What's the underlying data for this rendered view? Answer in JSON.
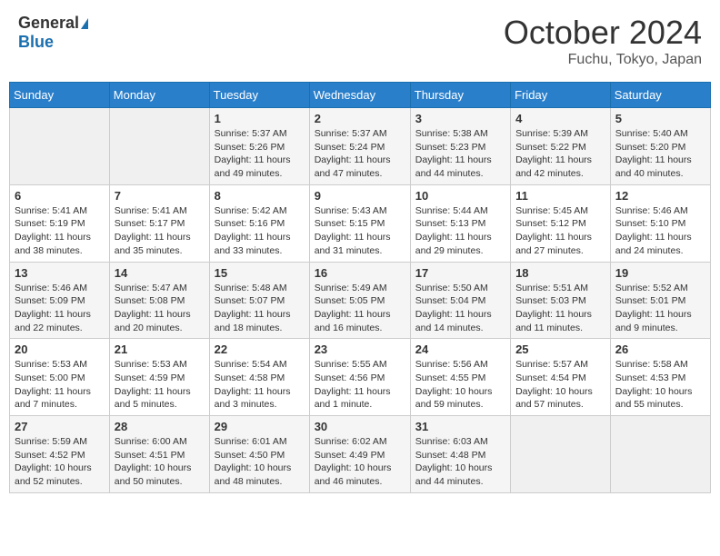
{
  "header": {
    "logo_general": "General",
    "logo_blue": "Blue",
    "month": "October 2024",
    "location": "Fuchu, Tokyo, Japan"
  },
  "days_of_week": [
    "Sunday",
    "Monday",
    "Tuesday",
    "Wednesday",
    "Thursday",
    "Friday",
    "Saturday"
  ],
  "weeks": [
    [
      {
        "day": "",
        "info": ""
      },
      {
        "day": "",
        "info": ""
      },
      {
        "day": "1",
        "sunrise": "5:37 AM",
        "sunset": "5:26 PM",
        "daylight": "11 hours and 49 minutes."
      },
      {
        "day": "2",
        "sunrise": "5:37 AM",
        "sunset": "5:24 PM",
        "daylight": "11 hours and 47 minutes."
      },
      {
        "day": "3",
        "sunrise": "5:38 AM",
        "sunset": "5:23 PM",
        "daylight": "11 hours and 44 minutes."
      },
      {
        "day": "4",
        "sunrise": "5:39 AM",
        "sunset": "5:22 PM",
        "daylight": "11 hours and 42 minutes."
      },
      {
        "day": "5",
        "sunrise": "5:40 AM",
        "sunset": "5:20 PM",
        "daylight": "11 hours and 40 minutes."
      }
    ],
    [
      {
        "day": "6",
        "sunrise": "5:41 AM",
        "sunset": "5:19 PM",
        "daylight": "11 hours and 38 minutes."
      },
      {
        "day": "7",
        "sunrise": "5:41 AM",
        "sunset": "5:17 PM",
        "daylight": "11 hours and 35 minutes."
      },
      {
        "day": "8",
        "sunrise": "5:42 AM",
        "sunset": "5:16 PM",
        "daylight": "11 hours and 33 minutes."
      },
      {
        "day": "9",
        "sunrise": "5:43 AM",
        "sunset": "5:15 PM",
        "daylight": "11 hours and 31 minutes."
      },
      {
        "day": "10",
        "sunrise": "5:44 AM",
        "sunset": "5:13 PM",
        "daylight": "11 hours and 29 minutes."
      },
      {
        "day": "11",
        "sunrise": "5:45 AM",
        "sunset": "5:12 PM",
        "daylight": "11 hours and 27 minutes."
      },
      {
        "day": "12",
        "sunrise": "5:46 AM",
        "sunset": "5:10 PM",
        "daylight": "11 hours and 24 minutes."
      }
    ],
    [
      {
        "day": "13",
        "sunrise": "5:46 AM",
        "sunset": "5:09 PM",
        "daylight": "11 hours and 22 minutes."
      },
      {
        "day": "14",
        "sunrise": "5:47 AM",
        "sunset": "5:08 PM",
        "daylight": "11 hours and 20 minutes."
      },
      {
        "day": "15",
        "sunrise": "5:48 AM",
        "sunset": "5:07 PM",
        "daylight": "11 hours and 18 minutes."
      },
      {
        "day": "16",
        "sunrise": "5:49 AM",
        "sunset": "5:05 PM",
        "daylight": "11 hours and 16 minutes."
      },
      {
        "day": "17",
        "sunrise": "5:50 AM",
        "sunset": "5:04 PM",
        "daylight": "11 hours and 14 minutes."
      },
      {
        "day": "18",
        "sunrise": "5:51 AM",
        "sunset": "5:03 PM",
        "daylight": "11 hours and 11 minutes."
      },
      {
        "day": "19",
        "sunrise": "5:52 AM",
        "sunset": "5:01 PM",
        "daylight": "11 hours and 9 minutes."
      }
    ],
    [
      {
        "day": "20",
        "sunrise": "5:53 AM",
        "sunset": "5:00 PM",
        "daylight": "11 hours and 7 minutes."
      },
      {
        "day": "21",
        "sunrise": "5:53 AM",
        "sunset": "4:59 PM",
        "daylight": "11 hours and 5 minutes."
      },
      {
        "day": "22",
        "sunrise": "5:54 AM",
        "sunset": "4:58 PM",
        "daylight": "11 hours and 3 minutes."
      },
      {
        "day": "23",
        "sunrise": "5:55 AM",
        "sunset": "4:56 PM",
        "daylight": "11 hours and 1 minute."
      },
      {
        "day": "24",
        "sunrise": "5:56 AM",
        "sunset": "4:55 PM",
        "daylight": "10 hours and 59 minutes."
      },
      {
        "day": "25",
        "sunrise": "5:57 AM",
        "sunset": "4:54 PM",
        "daylight": "10 hours and 57 minutes."
      },
      {
        "day": "26",
        "sunrise": "5:58 AM",
        "sunset": "4:53 PM",
        "daylight": "10 hours and 55 minutes."
      }
    ],
    [
      {
        "day": "27",
        "sunrise": "5:59 AM",
        "sunset": "4:52 PM",
        "daylight": "10 hours and 52 minutes."
      },
      {
        "day": "28",
        "sunrise": "6:00 AM",
        "sunset": "4:51 PM",
        "daylight": "10 hours and 50 minutes."
      },
      {
        "day": "29",
        "sunrise": "6:01 AM",
        "sunset": "4:50 PM",
        "daylight": "10 hours and 48 minutes."
      },
      {
        "day": "30",
        "sunrise": "6:02 AM",
        "sunset": "4:49 PM",
        "daylight": "10 hours and 46 minutes."
      },
      {
        "day": "31",
        "sunrise": "6:03 AM",
        "sunset": "4:48 PM",
        "daylight": "10 hours and 44 minutes."
      },
      {
        "day": "",
        "info": ""
      },
      {
        "day": "",
        "info": ""
      }
    ]
  ]
}
